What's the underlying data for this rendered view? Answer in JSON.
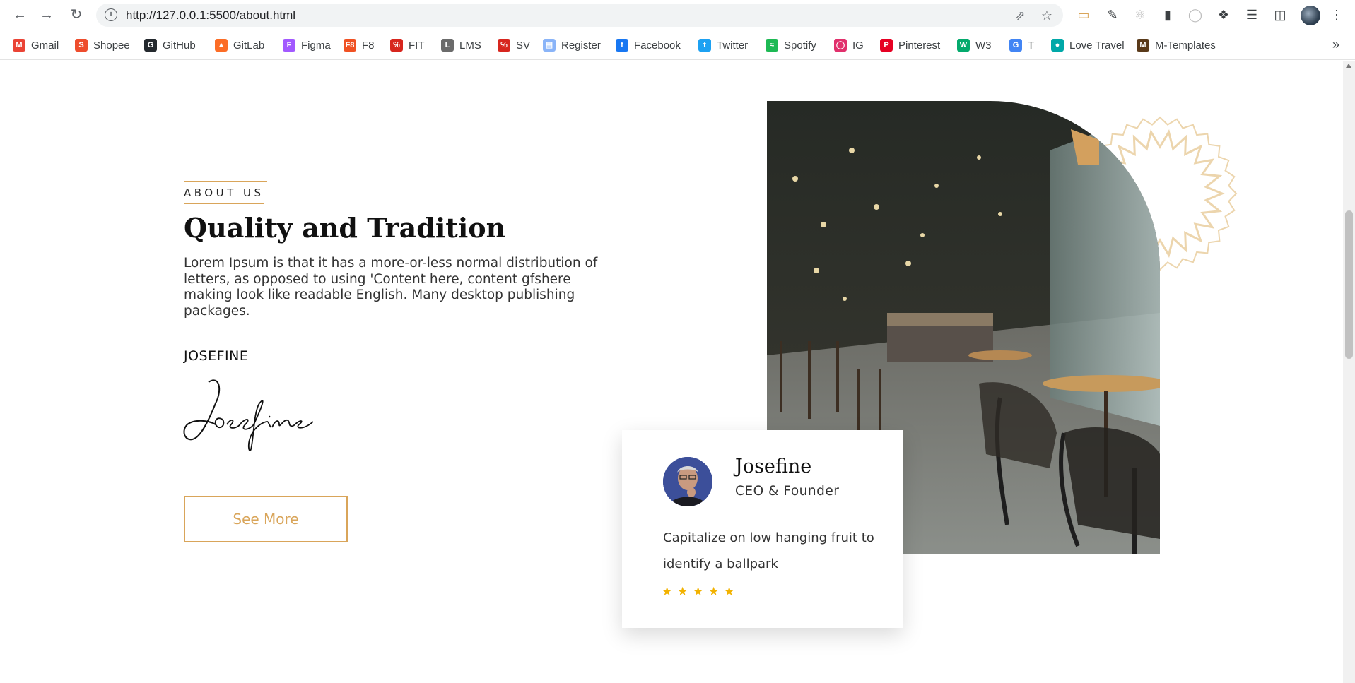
{
  "browser": {
    "url": "http://127.0.0.1:5500/about.html",
    "bookmarks": [
      {
        "label": "Gmail",
        "icon": "gmail-icon",
        "color": "#ea4335"
      },
      {
        "label": "Shopee",
        "icon": "shopee-icon",
        "color": "#ee4d2d"
      },
      {
        "label": "GitHub",
        "icon": "github-icon",
        "color": "#24292e"
      },
      {
        "label": "GitLab",
        "icon": "gitlab-icon",
        "color": "#fc6d26"
      },
      {
        "label": "Figma",
        "icon": "figma-icon",
        "color": "#a259ff"
      },
      {
        "label": "F8",
        "icon": "f8-icon",
        "color": "#f05123"
      },
      {
        "label": "FIT",
        "icon": "fit-icon",
        "color": "#d7261e"
      },
      {
        "label": "LMS",
        "icon": "lms-icon",
        "color": "#6b6b6b"
      },
      {
        "label": "SV",
        "icon": "sv-icon",
        "color": "#d7261e"
      },
      {
        "label": "Register",
        "icon": "document-icon",
        "color": "#8ab4f8"
      },
      {
        "label": "Facebook",
        "icon": "facebook-icon",
        "color": "#1877f2"
      },
      {
        "label": "Twitter",
        "icon": "twitter-icon",
        "color": "#1da1f2"
      },
      {
        "label": "Spotify",
        "icon": "spotify-icon",
        "color": "#1db954"
      },
      {
        "label": "IG",
        "icon": "instagram-icon",
        "color": "#e1306c"
      },
      {
        "label": "Pinterest",
        "icon": "pinterest-icon",
        "color": "#e60023"
      },
      {
        "label": "W3",
        "icon": "w3schools-icon",
        "color": "#04aa6d"
      },
      {
        "label": "T",
        "icon": "translate-icon",
        "color": "#4285f4"
      },
      {
        "label": "Love Travel",
        "icon": "love-travel-icon",
        "color": "#00a8a8"
      },
      {
        "label": "M-Templates",
        "icon": "m-templates-icon",
        "color": "#5a3a1a"
      }
    ]
  },
  "about": {
    "kicker": "ABOUT US",
    "heading": "Quality and Tradition",
    "description": "Lorem Ipsum is that it has a more-or-less normal distribution of letters, as opposed to using 'Content here, content gfshere making look like readable English. Many desktop publishing packages.",
    "signature_name": "JOSEFINE",
    "signature_text": "Josefine",
    "button_label": "See More",
    "accent_color": "#d9a55a"
  },
  "testimonial": {
    "name": "Josefine",
    "role": "CEO & Founder",
    "quote": "Capitalize on low hanging fruit to identify a ballpark",
    "rating": 5,
    "star_color": "#f2b200"
  }
}
